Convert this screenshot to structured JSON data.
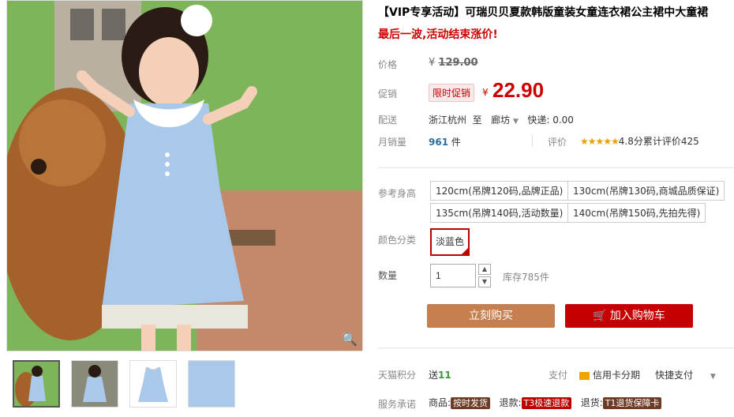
{
  "product": {
    "title": "【VIP专享活动】可瑞贝贝夏款韩版童装女童连衣裙公主裙中大童裙",
    "promo": "最后一波,活动结束涨价!"
  },
  "price": {
    "label": "价格",
    "currency": "¥",
    "original": "129.00",
    "promo_label": "促销",
    "limit_badge": "限时促销",
    "current": "22.90"
  },
  "shipping": {
    "label": "配送",
    "from": "浙江杭州",
    "to_word": "至",
    "to": "廊坊",
    "fee": "快递: 0.00"
  },
  "sales": {
    "label": "月销量",
    "count": "961",
    "unit": "件",
    "review_label": "评价",
    "stars": "★★★★★",
    "rating": "4.8分",
    "review_count": "累计评价425"
  },
  "options": {
    "size_label": "参考身高",
    "sizes": [
      "120cm(吊牌120码,品牌正品)",
      "130cm(吊牌130码,商城品质保证)",
      "135cm(吊牌140码,活动数量)",
      "140cm(吊牌150码,先拍先得)"
    ],
    "color_label": "颜色分类",
    "color": "淡蓝色",
    "qty_label": "数量",
    "qty": "1",
    "stock": "库存785件"
  },
  "actions": {
    "buy": "立刻购买",
    "cart": "加入购物车"
  },
  "extras": {
    "points_label": "天猫积分",
    "points_prefix": "送",
    "points": "11",
    "pay_label": "支付",
    "credit": "信用卡分期",
    "quick_pay": "快捷支付",
    "service_label": "服务承诺",
    "goods_prefix": "商品:",
    "goods_tag": "按时发货",
    "refund_prefix": "退款:",
    "refund_tag": "T3极速退款",
    "return_prefix": "退货:",
    "return_tag": "T1退货保障卡"
  },
  "colors": {
    "accent_red": "#c40000",
    "buy_button": "#c67f4e",
    "star": "#e8a200",
    "dress_blue": "#a9c8ea"
  }
}
